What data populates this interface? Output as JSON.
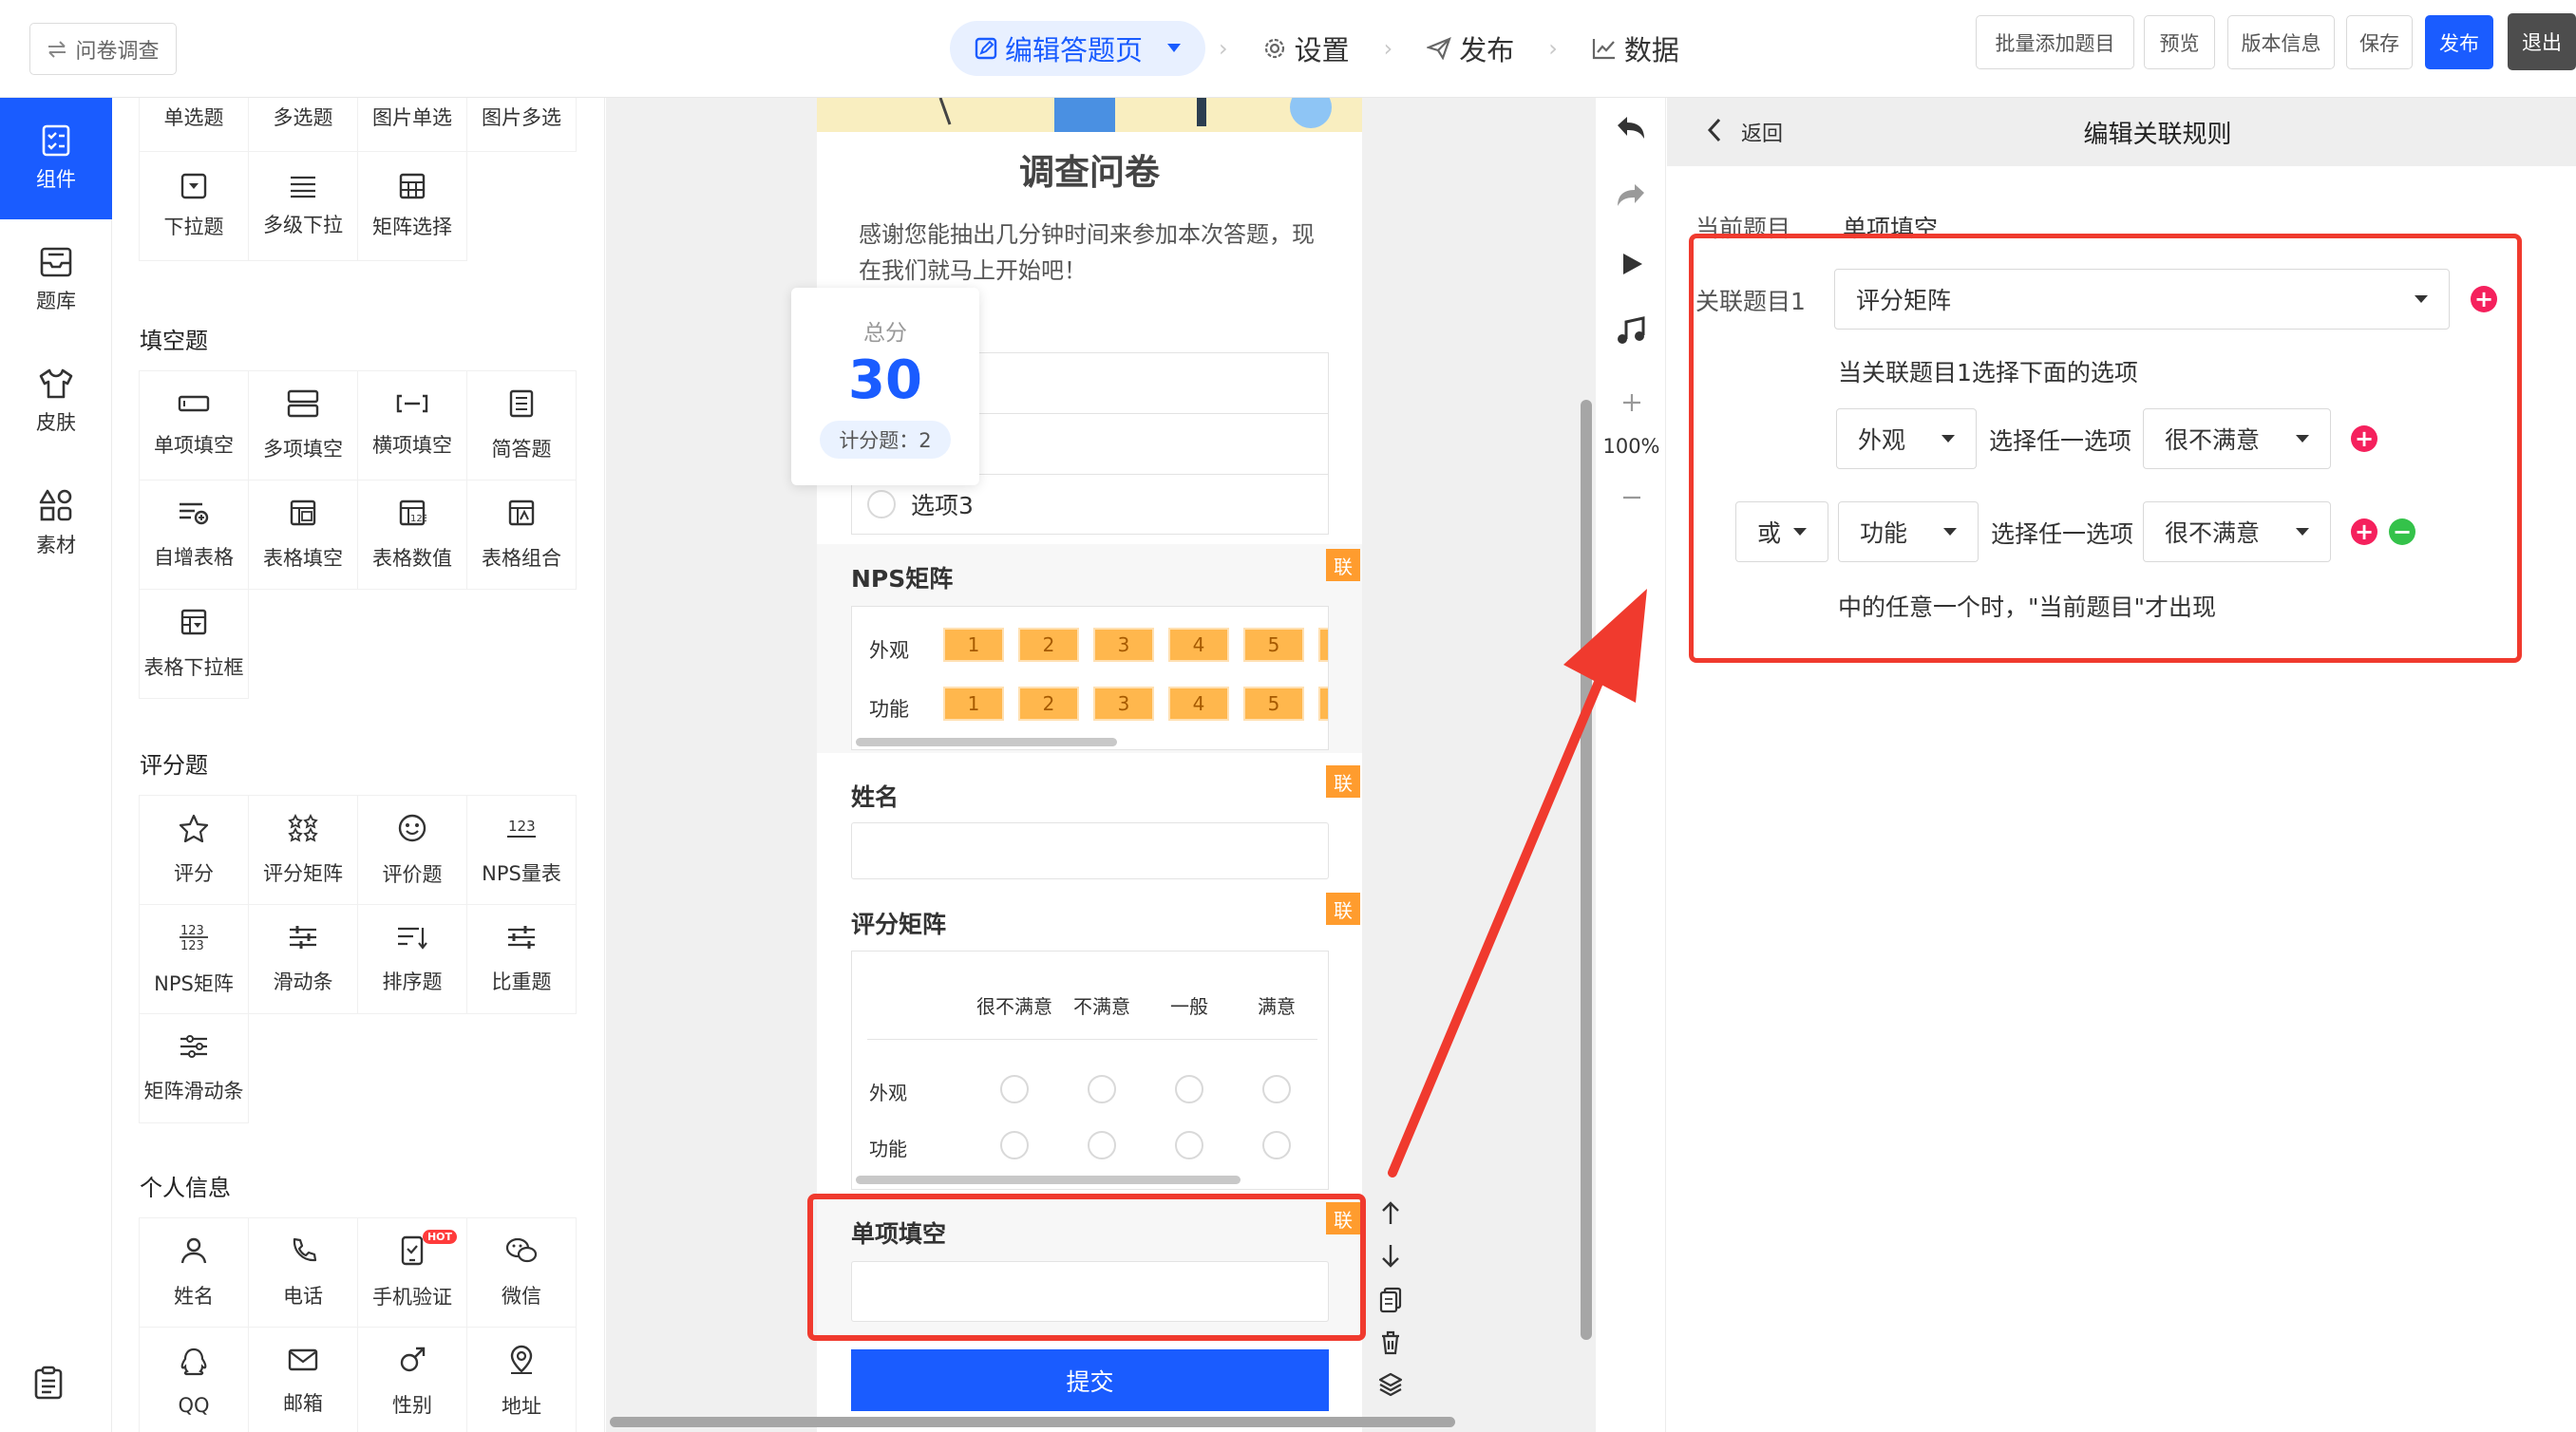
{
  "header": {
    "back_label": "问卷调查",
    "steps": [
      "编辑答题页",
      "设置",
      "发布",
      "数据"
    ],
    "buttons": [
      "批量添加题目",
      "预览",
      "版本信息",
      "保存",
      "发布",
      "退出"
    ],
    "accent": "#1a5cff"
  },
  "rail": {
    "items": [
      "组件",
      "题库",
      "皮肤",
      "素材"
    ]
  },
  "panel": {
    "top_items": [
      "单选题",
      "多选题",
      "图片单选",
      "图片多选",
      "下拉题",
      "多级下拉",
      "矩阵选择"
    ],
    "fill": {
      "title": "填空题",
      "items": [
        "单项填空",
        "多项填空",
        "横项填空",
        "简答题",
        "自增表格",
        "表格填空",
        "表格数值",
        "表格组合",
        "表格下拉框"
      ]
    },
    "score": {
      "title": "评分题",
      "items": [
        "评分",
        "评分矩阵",
        "评价题",
        "NPS量表",
        "NPS矩阵",
        "滑动条",
        "排序题",
        "比重题",
        "矩阵滑动条"
      ]
    },
    "personal": {
      "title": "个人信息",
      "items": [
        "姓名",
        "电话",
        "手机验证",
        "微信",
        "QQ",
        "邮箱",
        "性别",
        "地址"
      ],
      "hot": "HOT"
    }
  },
  "survey": {
    "title": "调查问卷",
    "intro": "感谢您能抽出几分钟时间来参加本次答题，现在我们就马上开始吧！",
    "option3": "选项3",
    "score_card": {
      "label": "总分",
      "value": "30",
      "count": "计分题：2"
    },
    "nps": {
      "title": "NPS矩阵",
      "rows": [
        "外观",
        "功能"
      ],
      "nums": [
        "1",
        "2",
        "3",
        "4",
        "5"
      ]
    },
    "name_title": "姓名",
    "rating": {
      "title": "评分矩阵",
      "cols": [
        "很不满意",
        "不满意",
        "一般",
        "满意"
      ],
      "rows": [
        "外观",
        "功能"
      ]
    },
    "single_fill_title": "单项填空",
    "submit": "提交",
    "lian": "联"
  },
  "tools": {
    "zoom": "100%"
  },
  "rule": {
    "back": "返回",
    "title": "编辑关联规则",
    "current_label": "当前题目",
    "current_value": "单项填空",
    "rel_label": "关联题目1",
    "rel_value": "评分矩阵",
    "hint": "当关联题目1选择下面的选项",
    "row1": {
      "item": "外观",
      "mid": "选择任一选项",
      "opt": "很不满意"
    },
    "row2": {
      "logic": "或",
      "item": "功能",
      "mid": "选择任一选项",
      "opt": "很不满意"
    },
    "footer": "中的任意一个时，\"当前题目\"才出现"
  },
  "colors": {
    "red": "#f03a2e",
    "add": "#f5215d",
    "remove": "#34c24a",
    "lian": "#ff9c2e"
  }
}
